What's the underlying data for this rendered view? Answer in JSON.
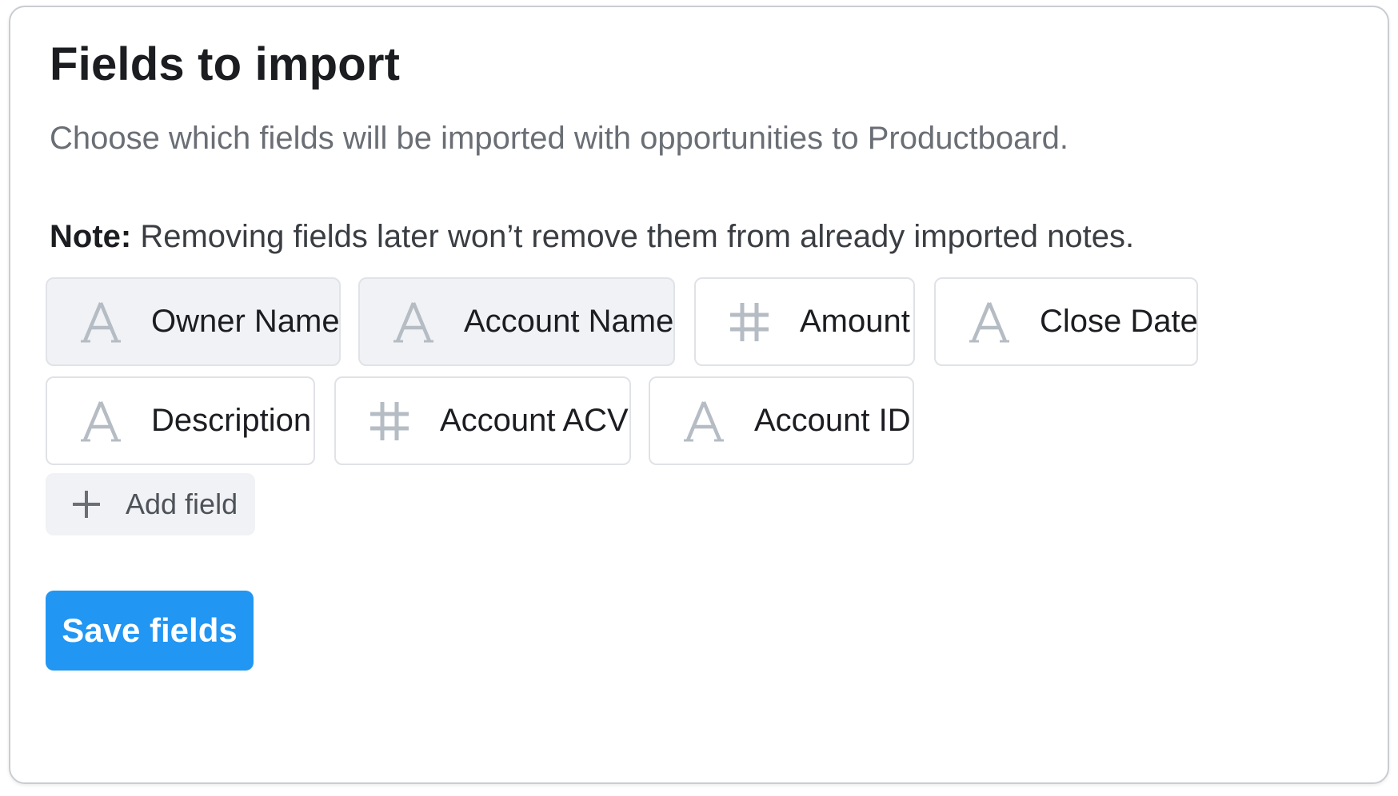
{
  "panel": {
    "title": "Fields to import",
    "subtitle": "Choose which fields will be imported with opportunities to Productboard.",
    "note_label": "Note:",
    "note_text": " Removing fields later won’t remove them from already imported notes."
  },
  "fields": [
    {
      "label": "Owner Name",
      "icon": "text-icon",
      "shaded": true
    },
    {
      "label": "Account Name",
      "icon": "text-icon",
      "shaded": true
    },
    {
      "label": "Amount",
      "icon": "number-icon",
      "shaded": false
    },
    {
      "label": "Close Date",
      "icon": "text-icon",
      "shaded": false
    },
    {
      "label": "Description",
      "icon": "text-icon",
      "shaded": false
    },
    {
      "label": "Account ACV",
      "icon": "number-icon",
      "shaded": false
    },
    {
      "label": "Account ID",
      "icon": "text-icon",
      "shaded": false
    }
  ],
  "add_field": {
    "label": "Add field",
    "icon": "plus-icon"
  },
  "save_button": {
    "label": "Save fields"
  },
  "colors": {
    "primary": "#2196f3",
    "icon_gray": "#b5bcc4",
    "chip_shaded_bg": "#f0f2f5",
    "border": "#dfe2e6"
  }
}
